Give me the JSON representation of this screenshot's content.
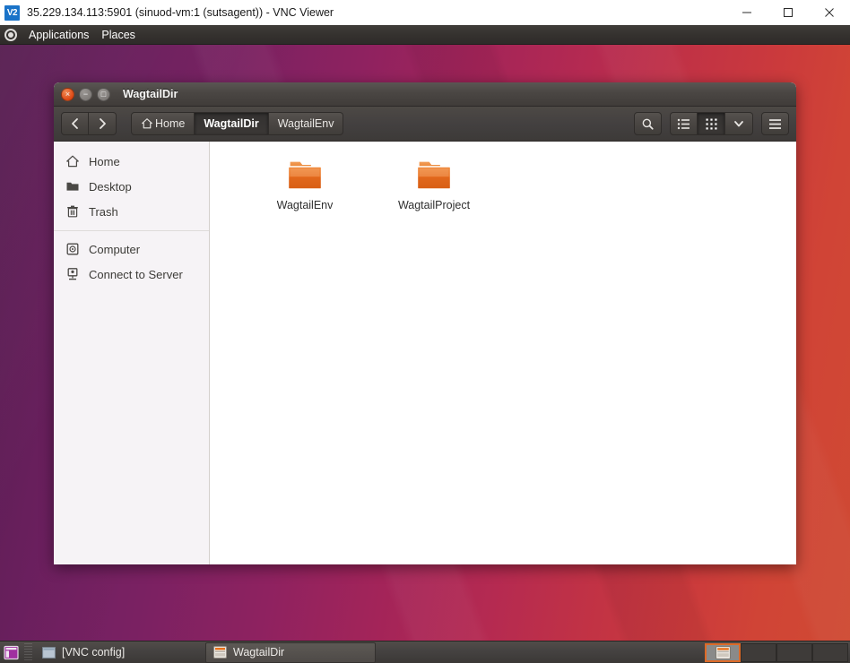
{
  "vnc_window": {
    "icon": "vnc-viewer-icon",
    "icon_text": "V2",
    "title": "35.229.134.113:5901 (sinuod-vm:1 (sutsagent)) - VNC Viewer",
    "controls": {
      "minimize_label": "─",
      "maximize_label": "□",
      "close_label": "✕"
    }
  },
  "ubuntu_panel": {
    "logo": "ubuntu-activities-icon",
    "menus": [
      "Applications",
      "Places"
    ]
  },
  "file_manager": {
    "title": "WagtailDir",
    "window_buttons": {
      "close": "×",
      "minimize": "−",
      "maximize": "□"
    },
    "nav": {
      "back": "back-arrow-icon",
      "forward": "forward-arrow-icon"
    },
    "breadcrumbs": [
      {
        "label": "Home",
        "icon": "home-icon",
        "active": false
      },
      {
        "label": "WagtailDir",
        "icon": "",
        "active": true
      },
      {
        "label": "WagtailEnv",
        "icon": "",
        "active": false
      }
    ],
    "toolbar_buttons": [
      {
        "name": "search-button",
        "icon": "search-icon",
        "active": false
      },
      {
        "name": "list-view-button",
        "icon": "list-view-icon",
        "active": false
      },
      {
        "name": "grid-view-button",
        "icon": "grid-view-icon",
        "active": true
      },
      {
        "name": "view-options-button",
        "icon": "chevron-down-icon",
        "active": false
      },
      {
        "name": "main-menu-button",
        "icon": "hamburger-menu-icon",
        "active": false
      }
    ],
    "sidebar": [
      {
        "label": "Home",
        "icon": "home-icon"
      },
      {
        "label": "Desktop",
        "icon": "folder-icon"
      },
      {
        "label": "Trash",
        "icon": "trash-icon"
      },
      {
        "separator": true
      },
      {
        "label": "Computer",
        "icon": "computer-disk-icon"
      },
      {
        "label": "Connect to Server",
        "icon": "connect-to-server-icon"
      }
    ],
    "files": [
      {
        "name": "WagtailEnv",
        "type": "folder"
      },
      {
        "name": "WagtailProject",
        "type": "folder"
      }
    ]
  },
  "taskbar": {
    "show_desktop": "show-desktop-icon",
    "tasks": [
      {
        "label": "[VNC config]",
        "icon": "window-icon",
        "active": false
      },
      {
        "label": "WagtailDir",
        "icon": "file-manager-icon",
        "active": true
      }
    ],
    "workspaces": [
      {
        "index": 1,
        "active": true,
        "has_window": true
      },
      {
        "index": 2,
        "active": false,
        "has_window": false
      },
      {
        "index": 3,
        "active": false,
        "has_window": false
      },
      {
        "index": 4,
        "active": false,
        "has_window": false
      }
    ]
  },
  "colors": {
    "ubuntu_orange": "#dd4814",
    "panel_dark": "#3d3a38",
    "folder_orange": "#e8701a",
    "desktop_purple": "#5c1f56",
    "desktop_red": "#cf4a33",
    "sidebar_bg": "#f6f3f6",
    "vnc_icon_blue": "#1a73c8"
  }
}
